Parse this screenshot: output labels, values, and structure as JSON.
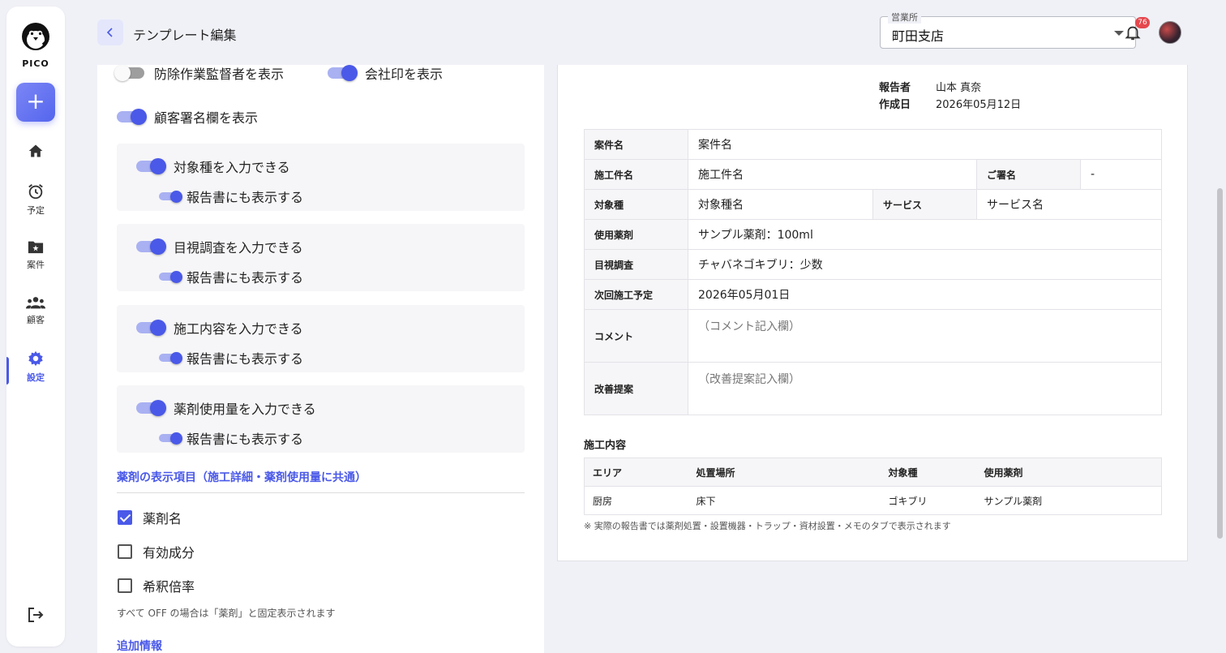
{
  "sidebar": {
    "logo_text": "PICO",
    "add_label": "+",
    "items": [
      {
        "label": ""
      },
      {
        "label": "予定"
      },
      {
        "label": "案件"
      },
      {
        "label": "顧客"
      },
      {
        "label": "設定"
      }
    ]
  },
  "header": {
    "title": "テンプレート編集",
    "branch_label": "営業所",
    "branch_value": "町田支店",
    "notification_count": "76"
  },
  "settings": {
    "toggle_supervisor": "防除作業監督者を表示",
    "toggle_company_seal": "会社印を表示",
    "toggle_customer_sign": "顧客署名欄を表示",
    "cards": [
      {
        "main": "対象種を入力できる",
        "sub": "報告書にも表示する"
      },
      {
        "main": "目視調査を入力できる",
        "sub": "報告書にも表示する"
      },
      {
        "main": "施工内容を入力できる",
        "sub": "報告書にも表示する"
      },
      {
        "main": "薬剤使用量を入力できる",
        "sub": "報告書にも表示する"
      }
    ],
    "chem_section_title": "薬剤の表示項目（施工詳細・薬剤使用量に共通）",
    "checkboxes": [
      {
        "label": "薬剤名",
        "checked": true
      },
      {
        "label": "有効成分",
        "checked": false
      },
      {
        "label": "希釈倍率",
        "checked": false
      }
    ],
    "chem_note": "すべて OFF の場合は「薬剤」と固定表示されます",
    "extra_section_title": "追加情報"
  },
  "preview": {
    "reporter_label": "報告者",
    "reporter_value": "山本 真奈",
    "created_label": "作成日",
    "created_value": "2026年05月12日",
    "rows": {
      "case_label": "案件名",
      "case_value": "案件名",
      "work_label": "施工件名",
      "work_value": "施工件名",
      "sign_label": "ご署名",
      "sign_value": "-",
      "species_label": "対象種",
      "species_value": "対象種名",
      "service_label": "サービス",
      "service_value": "サービス名",
      "chem_label": "使用薬剤",
      "chem_value": "サンプル薬剤：100ml",
      "visual_label": "目視調査",
      "visual_value": "チャバネゴキブリ：少数",
      "next_label": "次回施工予定",
      "next_value": "2026年05月01日",
      "comment_label": "コメント",
      "comment_value": "（コメント記入欄）",
      "improve_label": "改善提案",
      "improve_value": "（改善提案記入欄）"
    },
    "work_section_title": "施工内容",
    "work_headers": [
      "エリア",
      "処置場所",
      "対象種",
      "使用薬剤"
    ],
    "work_rows": [
      [
        "厨房",
        "床下",
        "ゴキブリ",
        "サンプル薬剤"
      ]
    ],
    "footnote": "※ 実際の報告書では薬剤処置・設置機器・トラップ・資材設置・メモのタブで表示されます"
  },
  "colors": {
    "accent": "#4a59e8",
    "badge": "#e5484d"
  }
}
